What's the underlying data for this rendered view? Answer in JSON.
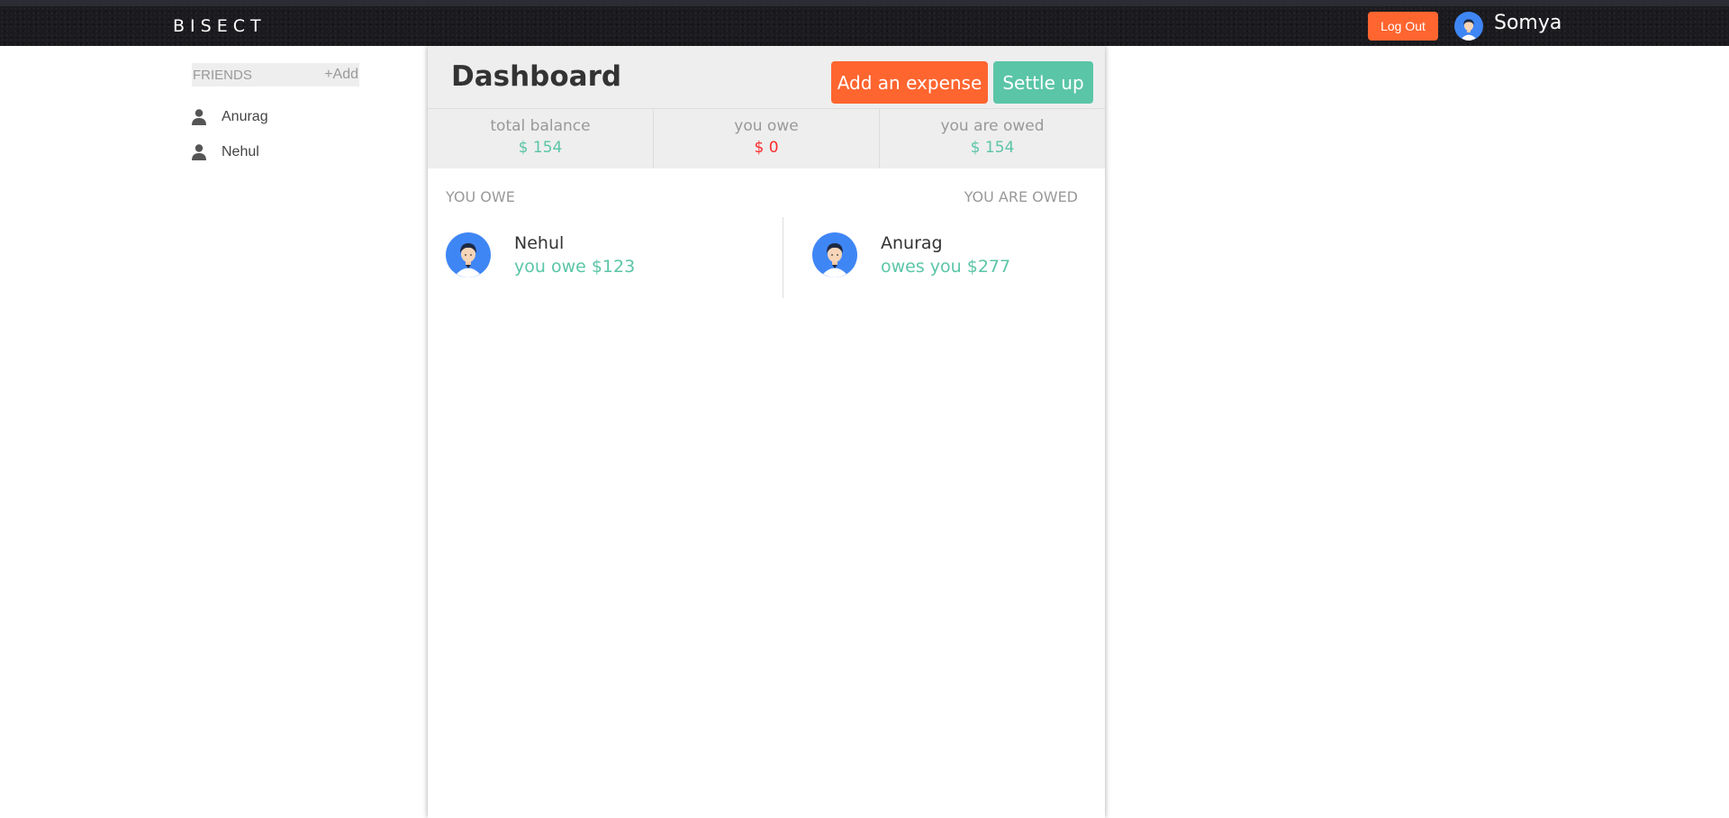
{
  "topbar": {
    "brand": "BISECT",
    "logout_label": "Log Out",
    "user_name": "Somya"
  },
  "sidebar": {
    "title": "FRIENDS",
    "add_label": "+Add",
    "friends": [
      {
        "name": "Anurag",
        "icon": "person-icon"
      },
      {
        "name": "Nehul",
        "icon": "person-icon"
      }
    ]
  },
  "main": {
    "title": "Dashboard",
    "add_expense_label": "Add an expense",
    "settle_up_label": "Settle up",
    "balances": [
      {
        "label": "total balance",
        "value": "$ 154",
        "color": "#5bc5a7"
      },
      {
        "label": "you owe",
        "value": "$ 0",
        "color": "#ff2b2b"
      },
      {
        "label": "you are owed",
        "value": "$ 154",
        "color": "#5bc5a7"
      }
    ],
    "you_owe": {
      "title": "YOU OWE",
      "items": [
        {
          "name": "Nehul",
          "detail": "you owe $123"
        }
      ]
    },
    "you_are_owed": {
      "title": "YOU ARE OWED",
      "items": [
        {
          "name": "Anurag",
          "detail": "owes you $277"
        }
      ]
    }
  },
  "colors": {
    "accent_orange": "#ff652f",
    "accent_green": "#5bc5a7",
    "negative_red": "#ff2b2b"
  }
}
